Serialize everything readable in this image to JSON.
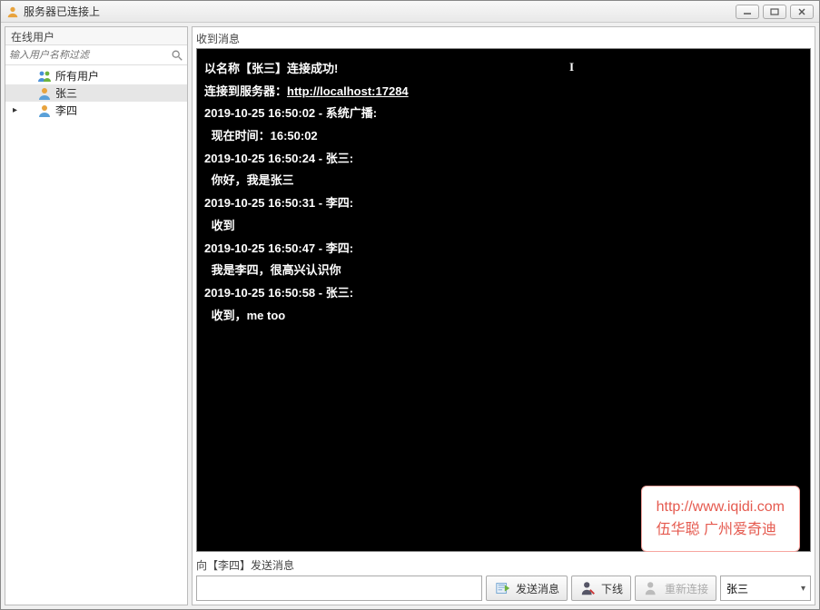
{
  "window": {
    "title": "服务器已连接上"
  },
  "sidebar": {
    "header": "在线用户",
    "search_placeholder": "输入用户名称过滤",
    "items": [
      {
        "label": "所有用户",
        "icon": "users-icon",
        "selected": false,
        "focused": false
      },
      {
        "label": "张三",
        "icon": "user-icon",
        "selected": true,
        "focused": false
      },
      {
        "label": "李四",
        "icon": "user-icon",
        "selected": false,
        "focused": true
      }
    ]
  },
  "messages": {
    "header": "收到消息",
    "connect_line": "以名称【张三】连接成功!",
    "server_prefix": "连接到服务器：",
    "server_url": "http://localhost:17284",
    "logs": [
      {
        "ts": "2019-10-25 16:50:02",
        "from": "系统广播",
        "body": "现在时间：16:50:02"
      },
      {
        "ts": "2019-10-25 16:50:24",
        "from": "张三",
        "body": "你好，我是张三"
      },
      {
        "ts": "2019-10-25 16:50:31",
        "from": "李四",
        "body": "收到"
      },
      {
        "ts": "2019-10-25 16:50:47",
        "from": "李四",
        "body": "我是李四，很高兴认识你"
      },
      {
        "ts": "2019-10-25 16:50:58",
        "from": "张三",
        "body": "收到，me too"
      }
    ]
  },
  "send": {
    "label": "向【李四】发送消息",
    "send_btn": "发送消息",
    "offline_btn": "下线",
    "reconnect_btn": "重新连接",
    "username": "张三"
  },
  "watermark": {
    "url": "http://www.iqidi.com",
    "name": "伍华聪 广州爱奇迪"
  }
}
